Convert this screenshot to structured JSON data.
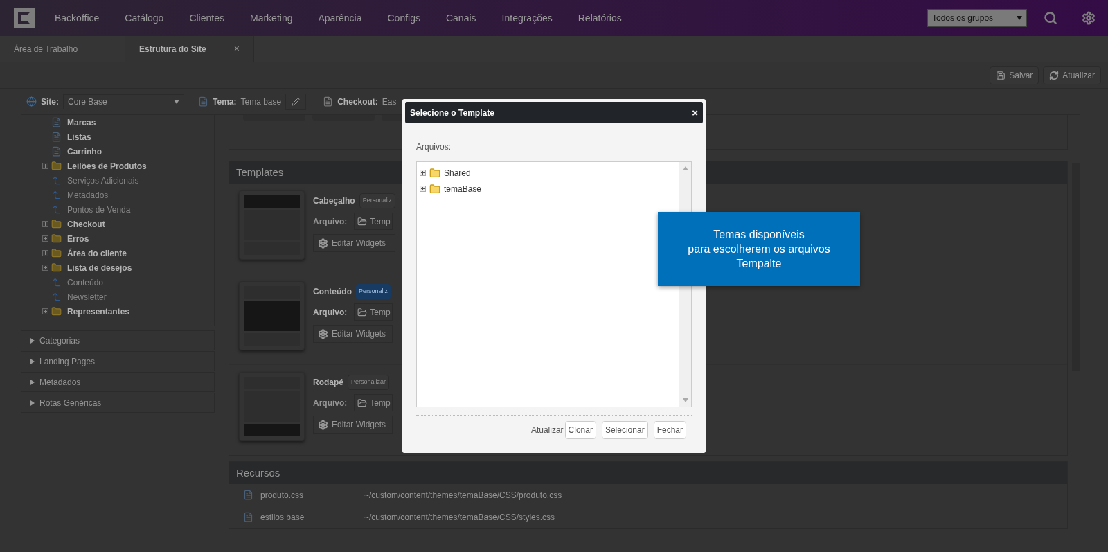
{
  "nav": {
    "items": [
      "Backoffice",
      "Catálogo",
      "Clientes",
      "Marketing",
      "Aparência",
      "Configs",
      "Canais",
      "Integrações",
      "Relatórios"
    ],
    "group_select": "Todos os grupos"
  },
  "tabs": [
    {
      "label": "Área de Trabalho",
      "selected": false
    },
    {
      "label": "Estrutura do Site",
      "selected": true,
      "close": "×"
    }
  ],
  "actions": [
    "Salvar",
    "Atualizar"
  ],
  "site_bar": {
    "site_label": "Site:",
    "site_value": "Core Base",
    "theme_label": "Tema:",
    "theme_value": "Tema base",
    "checkout_label": "Checkout:",
    "checkout_value": "Eas"
  },
  "tree": [
    {
      "label": "Marcas",
      "kind": "page",
      "disabled": false
    },
    {
      "label": "Listas",
      "kind": "page",
      "disabled": false
    },
    {
      "label": "Carrinho",
      "kind": "page",
      "disabled": false
    },
    {
      "label": "Leilões de Produtos",
      "kind": "folder",
      "disabled": false
    },
    {
      "label": "Serviços Adicionais",
      "kind": "route",
      "disabled": true
    },
    {
      "label": "Metadados",
      "kind": "route",
      "disabled": true
    },
    {
      "label": "Pontos de Venda",
      "kind": "route",
      "disabled": true
    },
    {
      "label": "Checkout",
      "kind": "folder",
      "disabled": false
    },
    {
      "label": "Erros",
      "kind": "folder",
      "disabled": false
    },
    {
      "label": "Área do cliente",
      "kind": "folder",
      "disabled": false
    },
    {
      "label": "Lista de desejos",
      "kind": "folder",
      "disabled": false
    },
    {
      "label": "Conteúdo",
      "kind": "route",
      "disabled": true
    },
    {
      "label": "Newsletter",
      "kind": "route",
      "disabled": true
    },
    {
      "label": "Representantes",
      "kind": "folder",
      "disabled": false
    }
  ],
  "accordion": [
    "Categorias",
    "Landing Pages",
    "Metadados",
    "Rotas Genéricas"
  ],
  "templates": {
    "title": "Templates",
    "items": [
      {
        "name": "Cabeçalho",
        "kind": "header",
        "customize": "Personaliz",
        "file_label": "Arquivo:",
        "file": "Temp",
        "widgets": "Editar Widgets",
        "selected": false
      },
      {
        "name": "Conteúdo",
        "kind": "body",
        "customize": "Personaliz",
        "file_label": "Arquivo:",
        "file": "Temp",
        "widgets": "Editar Widgets",
        "selected": true
      },
      {
        "name": "Rodapé",
        "kind": "footer",
        "customize": "Personalizar",
        "file_label": "Arquivo:",
        "file": "Temp",
        "widgets": "Editar Widgets",
        "selected": false
      }
    ]
  },
  "resources": {
    "title": "Recursos",
    "rows": [
      {
        "name": "produto.css",
        "path": "~/custom/content/themes/temaBase/CSS/produto.css"
      },
      {
        "name": "estilos base",
        "path": "~/custom/content/themes/temaBase/CSS/styles.css"
      }
    ]
  },
  "dialog": {
    "title": "Selecione o Template",
    "close": "×",
    "files_label": "Arquivos:",
    "folders": [
      "Shared",
      "temaBase"
    ],
    "refresh": "Atualizar",
    "buttons": [
      "Clonar",
      "Selecionar",
      "Fechar"
    ]
  },
  "callout": "Temas disponíveis\npara escolherem os arquivos\nTempalte"
}
